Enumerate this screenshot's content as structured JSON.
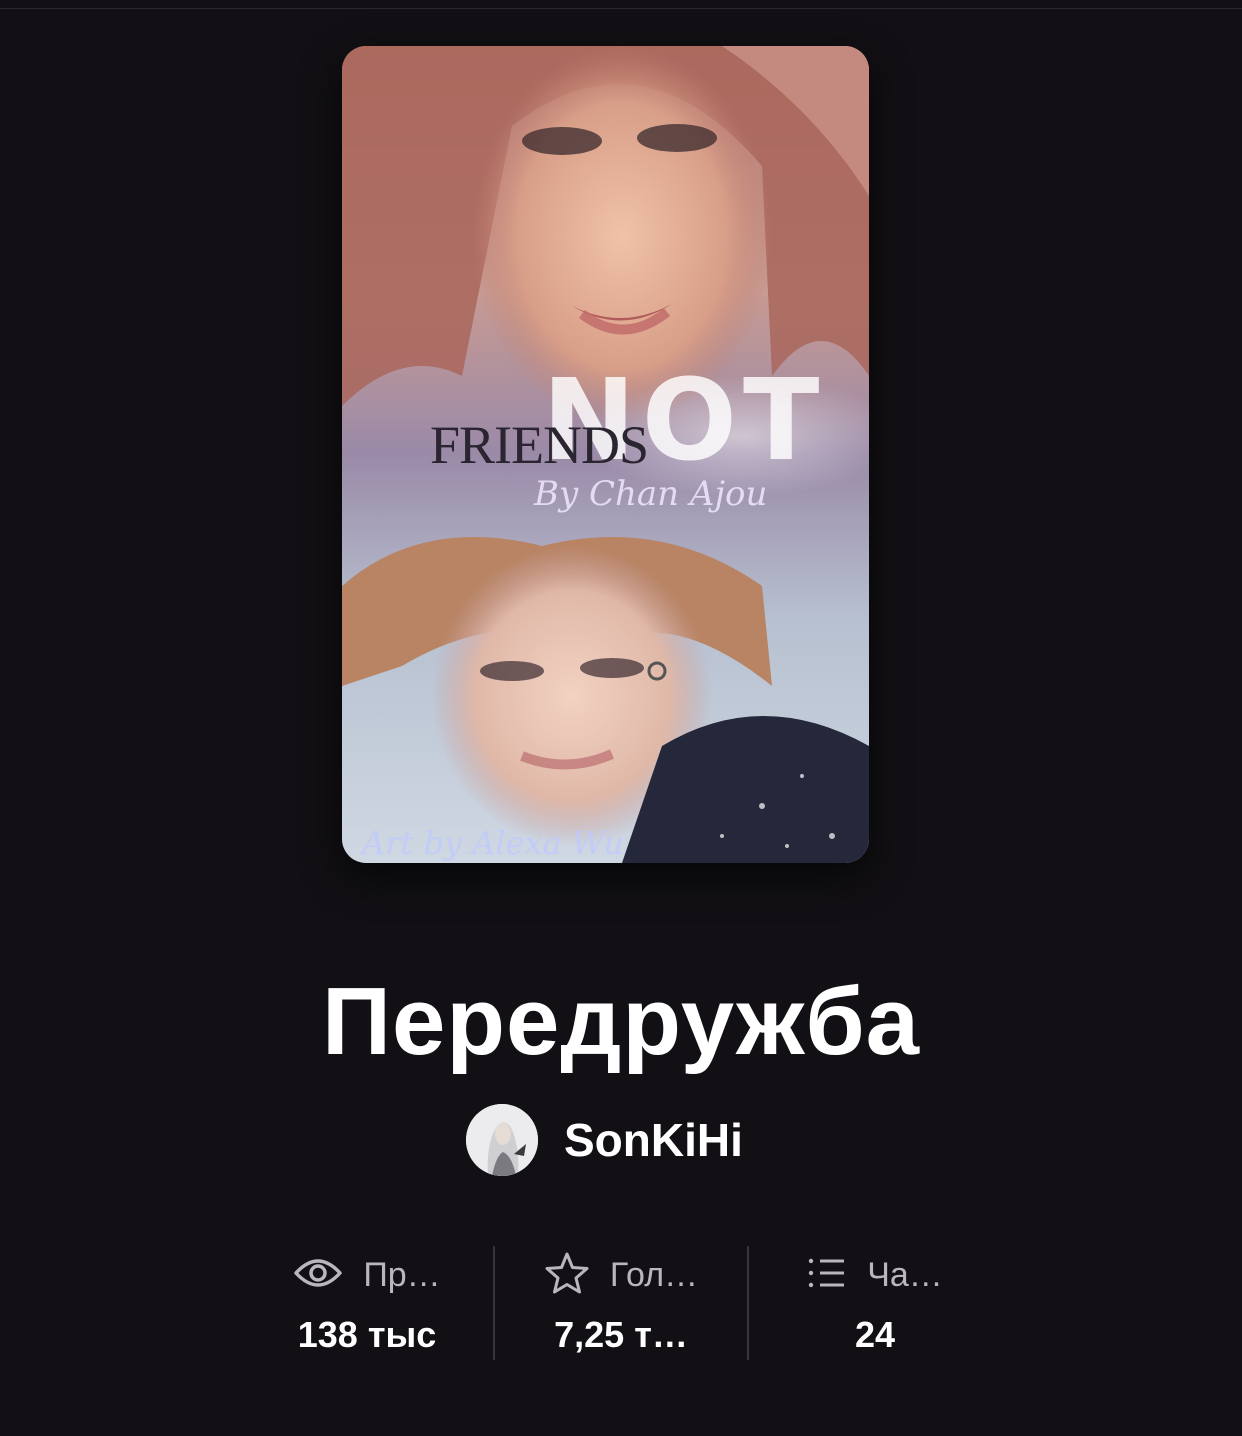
{
  "cover": {
    "title_word_1": "FRIENDS",
    "title_word_2": "NOT",
    "byline": "By Chan Ajou",
    "art_credit": "Art by Alexa Wu"
  },
  "story": {
    "title": "Передружба"
  },
  "author": {
    "name": "SonKiHi",
    "avatar_icon": "author-avatar"
  },
  "stats": [
    {
      "icon": "eye-icon",
      "label": "Пр…",
      "value": "138 тыс"
    },
    {
      "icon": "star-icon",
      "label": "Гол…",
      "value": "7,25 т…"
    },
    {
      "icon": "list-icon",
      "label": "Ча…",
      "value": "24"
    }
  ]
}
